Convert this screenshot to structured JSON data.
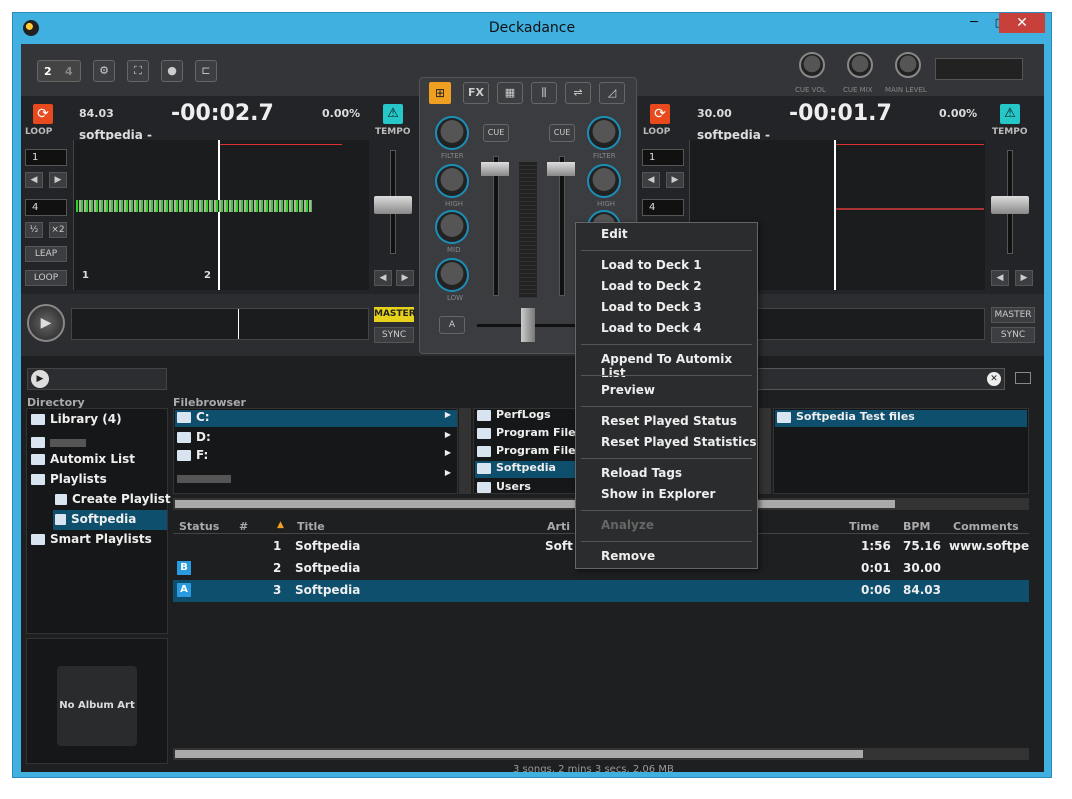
{
  "window": {
    "title": "Deckadance",
    "min": "─",
    "max": "□",
    "close": "✕"
  },
  "topbar": {
    "deck2": "2",
    "deck4": "4"
  },
  "knobs": {
    "cue_vol": "CUE VOL",
    "cue_mix": "CUE MIX",
    "main_level": "MAIN LEVEL"
  },
  "deckA": {
    "bpm": "84.03",
    "time": "-00:02.7",
    "pitch": "0.00%",
    "title": "softpedia -",
    "loop": "LOOP",
    "tempo": "TEMPO",
    "sel1": "1",
    "sel4": "4",
    "half": "½",
    "x2": "×2",
    "leap": "LEAP",
    "loopbtn": "LOOP",
    "master": "MASTER",
    "sync": "SYNC",
    "marker1": "1",
    "marker2": "2"
  },
  "deckB": {
    "bpm": "30.00",
    "time": "-00:01.7",
    "pitch": "0.00%",
    "title": "softpedia -",
    "loop": "LOOP",
    "tempo": "TEMPO",
    "sel1": "1",
    "sel4": "4",
    "master": "MASTER",
    "sync": "SYNC"
  },
  "mixer": {
    "tabs": [
      "FX"
    ],
    "cue_left": "CUE",
    "cue_right": "CUE",
    "filter": "FILTER",
    "high": "HIGH",
    "mid": "MID",
    "low": "LOW",
    "xfader_a": "A"
  },
  "library": {
    "directory_label": "Directory",
    "filebrowser_label": "Filebrowser",
    "directory": [
      {
        "label": "Library (4)"
      },
      {
        "label": "Automix List"
      },
      {
        "label": "Playlists"
      },
      {
        "label": "Create Playlist"
      },
      {
        "label": "Softpedia"
      },
      {
        "label": "Smart Playlists"
      }
    ],
    "drives": [
      "C:",
      "D:",
      "F:"
    ],
    "folders": [
      "PerfLogs",
      "Program Files",
      "Program Files",
      "Softpedia",
      "Users"
    ],
    "subfolder": "Softpedia Test files",
    "no_album_art": "No Album Art",
    "columns": {
      "status": "Status",
      "num": "#",
      "title": "Title",
      "artist": "Arti",
      "time": "Time",
      "bpm": "BPM",
      "comments": "Comments"
    },
    "tracks": [
      {
        "num": "1",
        "title": "Softpedia",
        "artist": "Soft",
        "status": "",
        "time": "1:56",
        "bpm": "75.16",
        "comments": "www.softpedi"
      },
      {
        "num": "2",
        "title": "Softpedia",
        "artist": "",
        "status": "B",
        "time": "0:01",
        "bpm": "30.00",
        "comments": ""
      },
      {
        "num": "3",
        "title": "Softpedia",
        "artist": "",
        "status": "A",
        "time": "0:06",
        "bpm": "84.03",
        "comments": ""
      }
    ],
    "summary": "3 songs, 2 mins 3 secs, 2.06 MB"
  },
  "context_menu": {
    "items": [
      "Edit",
      "Load to Deck 1",
      "Load to Deck 2",
      "Load to Deck 3",
      "Load to Deck 4",
      "Append To Automix List",
      "Preview",
      "Reset Played Status",
      "Reset Played Statistics",
      "Reload Tags",
      "Show in Explorer",
      "Analyze",
      "Remove"
    ]
  },
  "colors": {
    "accent_orange": "#e84a1e",
    "accent_cyan": "#25c7c9",
    "selection": "#0e4f6e",
    "master_yellow": "#e6d21a"
  }
}
